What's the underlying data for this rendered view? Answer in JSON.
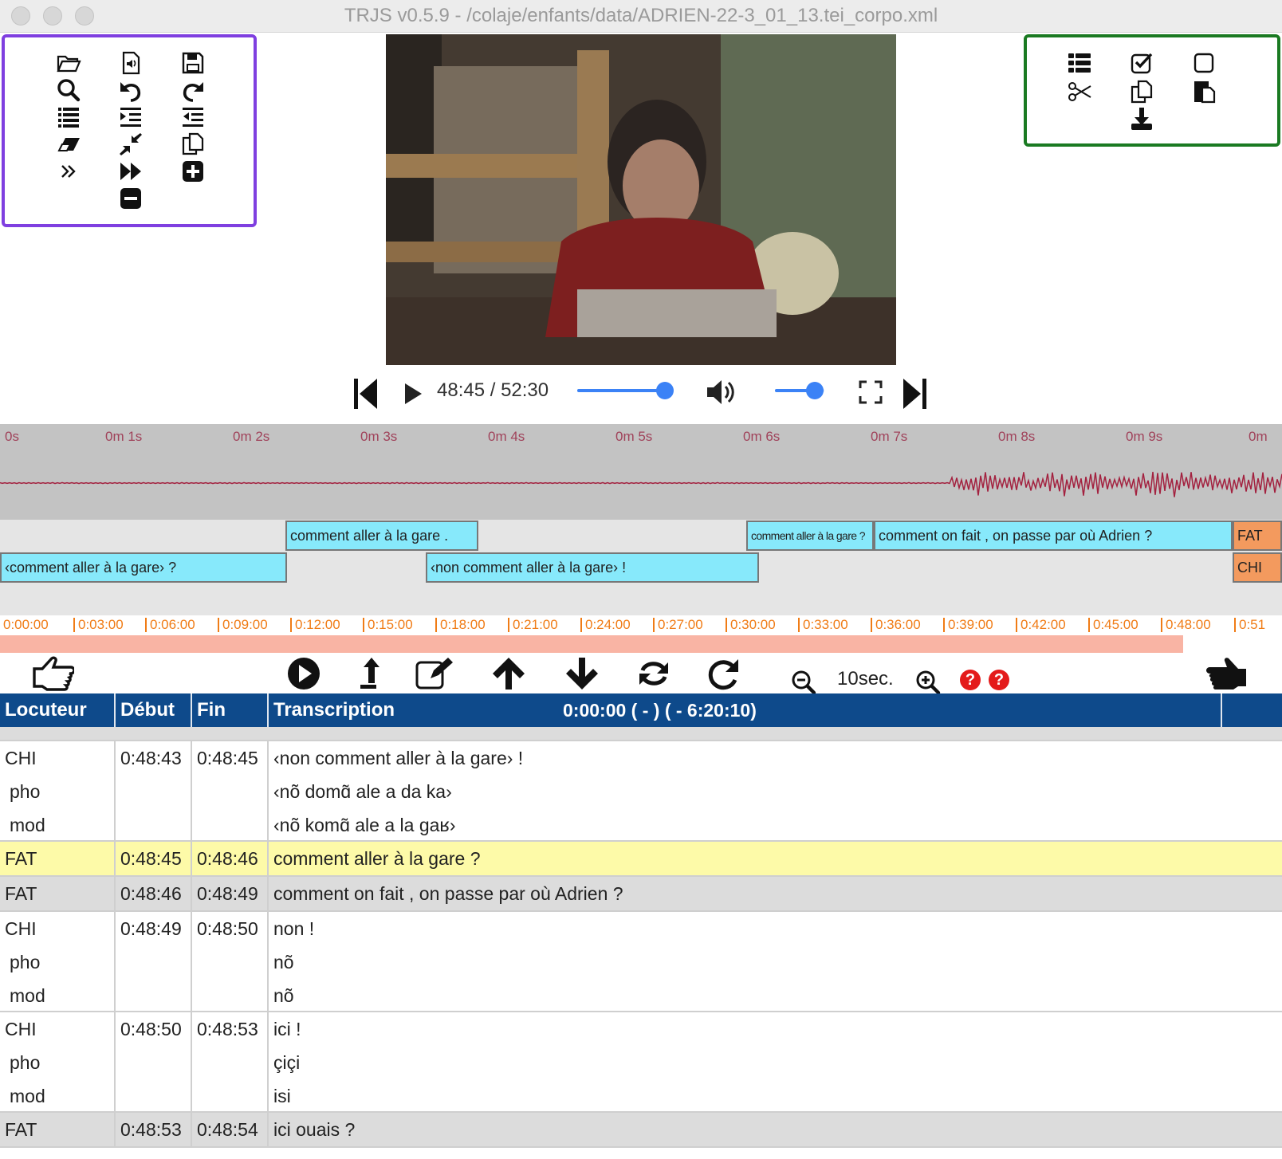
{
  "window": {
    "title": "TRJS v0.5.9 - /colaje/enfants/data/ADRIEN-22-3_01_13.tei_corpo.xml"
  },
  "colors": {
    "left_toolbar_border": "#7f3fe0",
    "right_toolbar_border": "#1a7a22",
    "header_bg": "#0e4a8b",
    "highlight_row": "#fdfaa8",
    "segment_fill": "#87e9fb",
    "segment_speaker": "#f39a5e",
    "timeline_text": "#f07c16",
    "wave_color": "#a3213f"
  },
  "toolbar_left": {
    "icons": [
      "folder-open-icon",
      "audio-file-icon",
      "save-icon",
      "search-icon",
      "undo-icon",
      "redo-icon",
      "list-icon",
      "indent-icon",
      "outdent-icon",
      "eraser-icon",
      "compress-icon",
      "copy-icon",
      "double-chevron-right-icon",
      "fast-forward-icon",
      "plus-square-icon",
      "minus-square-icon"
    ]
  },
  "toolbar_right": {
    "icons": [
      "list-ul-icon",
      "checkbox-checked-icon",
      "checkbox-empty-icon",
      "scissors-icon",
      "copy-icon",
      "paste-icon",
      "download-icon"
    ]
  },
  "player": {
    "time": "48:45 / 52:30",
    "progress": 0.929,
    "volume": 0.8
  },
  "wave_ruler": {
    "ticks": [
      "0s",
      "0m 1s",
      "0m 2s",
      "0m 3s",
      "0m 4s",
      "0m 5s",
      "0m 6s",
      "0m 7s",
      "0m 8s",
      "0m 9s",
      "0m"
    ]
  },
  "segments": {
    "row1": [
      "comment aller à la gare .",
      "comment aller à la gare ?",
      "comment on fait , on passe par où Adrien ?",
      "FAT"
    ],
    "row2": [
      "‹comment aller à la gare› ?",
      "‹non comment aller à la gare› !",
      "CHI"
    ]
  },
  "timeline": {
    "ticks": [
      "0:00:00",
      "0:03:00",
      "0:06:00",
      "0:09:00",
      "0:12:00",
      "0:15:00",
      "0:18:00",
      "0:21:00",
      "0:24:00",
      "0:27:00",
      "0:30:00",
      "0:33:00",
      "0:36:00",
      "0:39:00",
      "0:42:00",
      "0:45:00",
      "0:48:00",
      "0:51"
    ]
  },
  "toolbar2": {
    "zoom_label": "10sec.",
    "help": [
      "?",
      "?"
    ]
  },
  "table": {
    "headers": {
      "speaker": "Locuteur",
      "start": "Début",
      "end": "Fin",
      "transcription": "Transcription",
      "status": "0:00:00 ( - )  ( - 6:20:10)"
    },
    "rows": [
      {
        "speaker": "CHI",
        "start": "0:48:43",
        "end": "0:48:45",
        "text": "‹non comment aller à la gare› !",
        "tiers": [
          {
            "name": "pho",
            "text": "‹nõ domɑ̃ ale a da ka›"
          },
          {
            "name": "mod",
            "text": "‹nõ komɑ̃ ale a la gaʁ›"
          }
        ]
      },
      {
        "speaker": "FAT",
        "start": "0:48:45",
        "end": "0:48:46",
        "text": "comment aller à la gare ?",
        "tiers": []
      },
      {
        "speaker": "FAT",
        "start": "0:48:46",
        "end": "0:48:49",
        "text": "comment on fait , on passe par où Adrien ?",
        "tiers": []
      },
      {
        "speaker": "CHI",
        "start": "0:48:49",
        "end": "0:48:50",
        "text": "non !",
        "tiers": [
          {
            "name": "pho",
            "text": "nõ"
          },
          {
            "name": "mod",
            "text": "nõ"
          }
        ]
      },
      {
        "speaker": "CHI",
        "start": "0:48:50",
        "end": "0:48:53",
        "text": "ici !",
        "tiers": [
          {
            "name": "pho",
            "text": "çiçi"
          },
          {
            "name": "mod",
            "text": "isi"
          }
        ]
      },
      {
        "speaker": "FAT",
        "start": "0:48:53",
        "end": "0:48:54",
        "text": "ici ouais ?",
        "tiers": []
      }
    ]
  }
}
